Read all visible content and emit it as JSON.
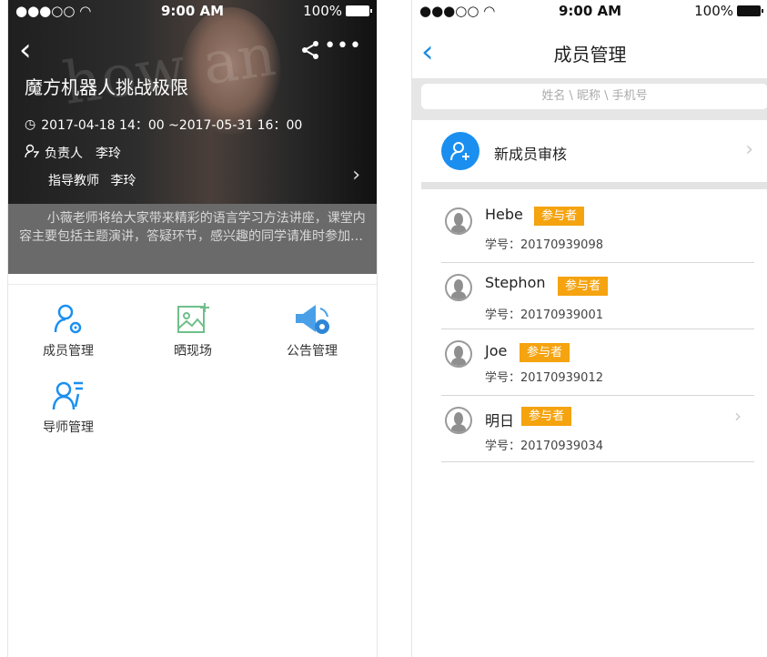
{
  "status_bar": {
    "signal": "●●●○○",
    "wifi": "wifi-icon",
    "time": "9:00 AM",
    "battery": "100%"
  },
  "left": {
    "hero": {
      "title": "魔方机器人挑战极限",
      "time": "2017-04-18 14：00 ~2017-05-31 16：00",
      "owner_label": "负责人",
      "owner": "李玲",
      "mentor_label": "指导教师",
      "mentor": "李玲"
    },
    "description": "小薇老师将给大家带来精彩的语言学习方法讲座，课堂内容主要包括主题演讲，答疑环节，感兴趣的同学请准时参加…",
    "menu": [
      {
        "label": "成员管理",
        "icon": "member-manage-icon"
      },
      {
        "label": "晒现场",
        "icon": "photo-add-icon"
      },
      {
        "label": "公告管理",
        "icon": "announcement-icon"
      },
      {
        "label": "导师管理",
        "icon": "mentor-manage-icon"
      }
    ]
  },
  "right": {
    "title": "成员管理",
    "search_placeholder": "姓名 \\ 昵称 \\ 手机号",
    "review_label": "新成员审核",
    "members": [
      {
        "name": "Hebe",
        "role": "参与者",
        "sid_label": "学号：",
        "sid": "20170939098"
      },
      {
        "name": "Stephon",
        "role": "参与者",
        "sid_label": "学号：",
        "sid": "20170939001"
      },
      {
        "name": "Joe",
        "role": "参与者",
        "sid_label": "学号：",
        "sid": "20170939012"
      },
      {
        "name": "明日",
        "role": "参与者",
        "sid_label": "学号：",
        "sid": "20170939034"
      }
    ]
  },
  "colors": {
    "accent": "#1a8ff0",
    "badge": "#f5a30f",
    "description_bg": "#6a6a6a"
  }
}
